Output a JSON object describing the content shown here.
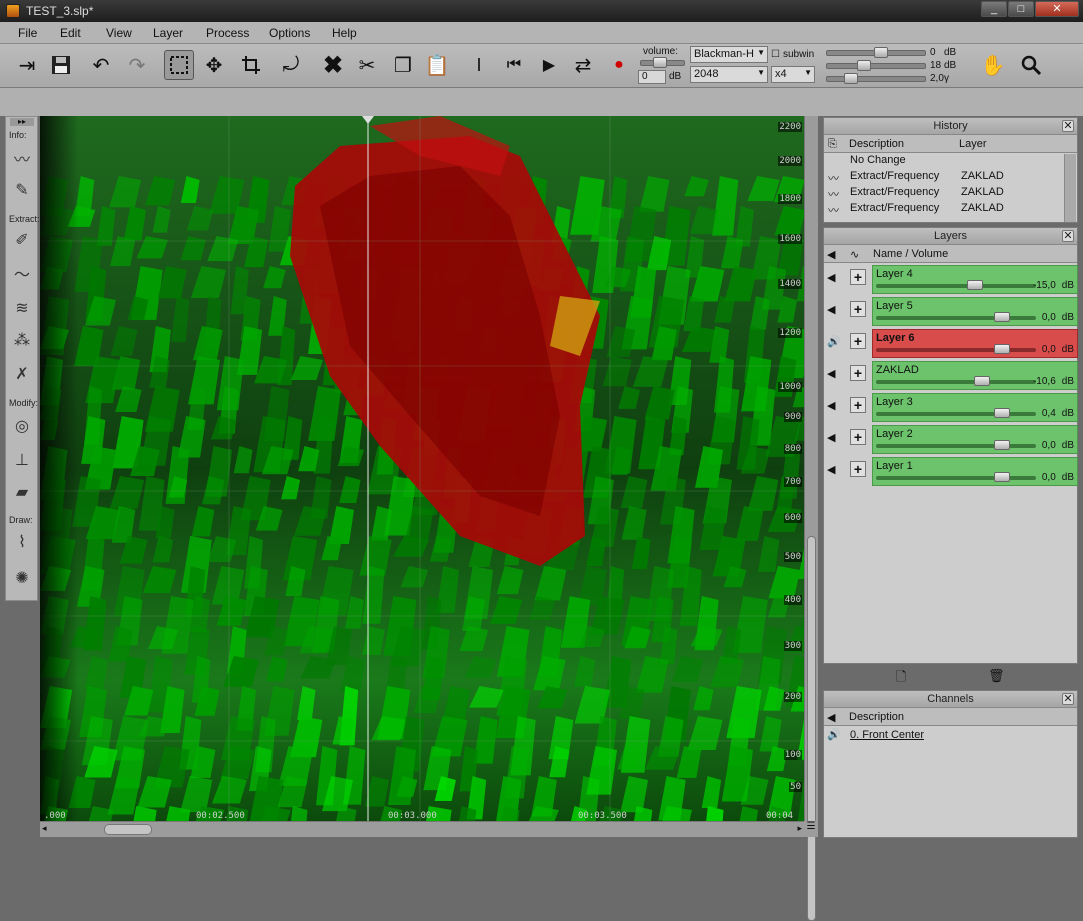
{
  "window": {
    "title": "TEST_3.slp*",
    "minimize": "_",
    "maximize": "□",
    "close": "✕"
  },
  "menu": [
    "File",
    "Edit",
    "View",
    "Layer",
    "Process",
    "Options",
    "Help"
  ],
  "toolbar": {
    "volume_label": "volume:",
    "volume_value": "0",
    "volume_unit": "dB",
    "window_fn": "Blackman-H",
    "fft_size": "2048",
    "overlap": "x4",
    "subwin_label": "subwin",
    "range_values": [
      {
        "value": "0",
        "unit": "dB",
        "level": 0.55
      },
      {
        "value": "18",
        "unit": "dB",
        "level": 0.35
      },
      {
        "value": "2,0",
        "unit": "γ",
        "level": 0.2
      }
    ]
  },
  "left_tools": {
    "info_label": "Info:",
    "extract_label": "Extract:",
    "modify_label": "Modify:",
    "draw_label": "Draw:"
  },
  "spectrogram": {
    "y_ticks": [
      "2200",
      "2000",
      "1800",
      "1600",
      "1400",
      "1200",
      "1000",
      "900",
      "800",
      "700",
      "600",
      "500",
      "400",
      "300",
      "200",
      "100",
      "50"
    ],
    "x_ticks": [
      ".000",
      "00:02.500",
      "00:03.000",
      "00:03.500",
      "00:04"
    ]
  },
  "history": {
    "title": "History",
    "col_description": "Description",
    "col_layer": "Layer",
    "rows": [
      {
        "description": "No Change",
        "layer": ""
      },
      {
        "description": "Extract/Frequency",
        "layer": "ZAKLAD"
      },
      {
        "description": "Extract/Frequency",
        "layer": "ZAKLAD"
      },
      {
        "description": "Extract/Frequency",
        "layer": "ZAKLAD"
      }
    ]
  },
  "layers": {
    "title": "Layers",
    "col_name": "Name / Volume",
    "rows": [
      {
        "name": "Layer 4",
        "volume": "-15,0",
        "unit": "dB",
        "level": 0.63,
        "active": false
      },
      {
        "name": "Layer 5",
        "volume": "0,0",
        "unit": "dB",
        "level": 0.82,
        "active": false
      },
      {
        "name": "Layer 6",
        "volume": "0,0",
        "unit": "dB",
        "level": 0.82,
        "active": true
      },
      {
        "name": "ZAKLAD",
        "volume": "-10,6",
        "unit": "dB",
        "level": 0.68,
        "active": false
      },
      {
        "name": "Layer 3",
        "volume": "0,4",
        "unit": "dB",
        "level": 0.82,
        "active": false
      },
      {
        "name": "Layer 2",
        "volume": "0,0",
        "unit": "dB",
        "level": 0.82,
        "active": false
      },
      {
        "name": "Layer 1",
        "volume": "0,0",
        "unit": "dB",
        "level": 0.82,
        "active": false
      }
    ]
  },
  "channels": {
    "title": "Channels",
    "col_description": "Description",
    "rows": [
      "0. Front Center"
    ]
  },
  "colors": {
    "layer_green": "#6cc36c",
    "layer_active": "#d94c4c",
    "spectrum_low": "#0a5a0a",
    "spectrum_high": "#d01010"
  }
}
